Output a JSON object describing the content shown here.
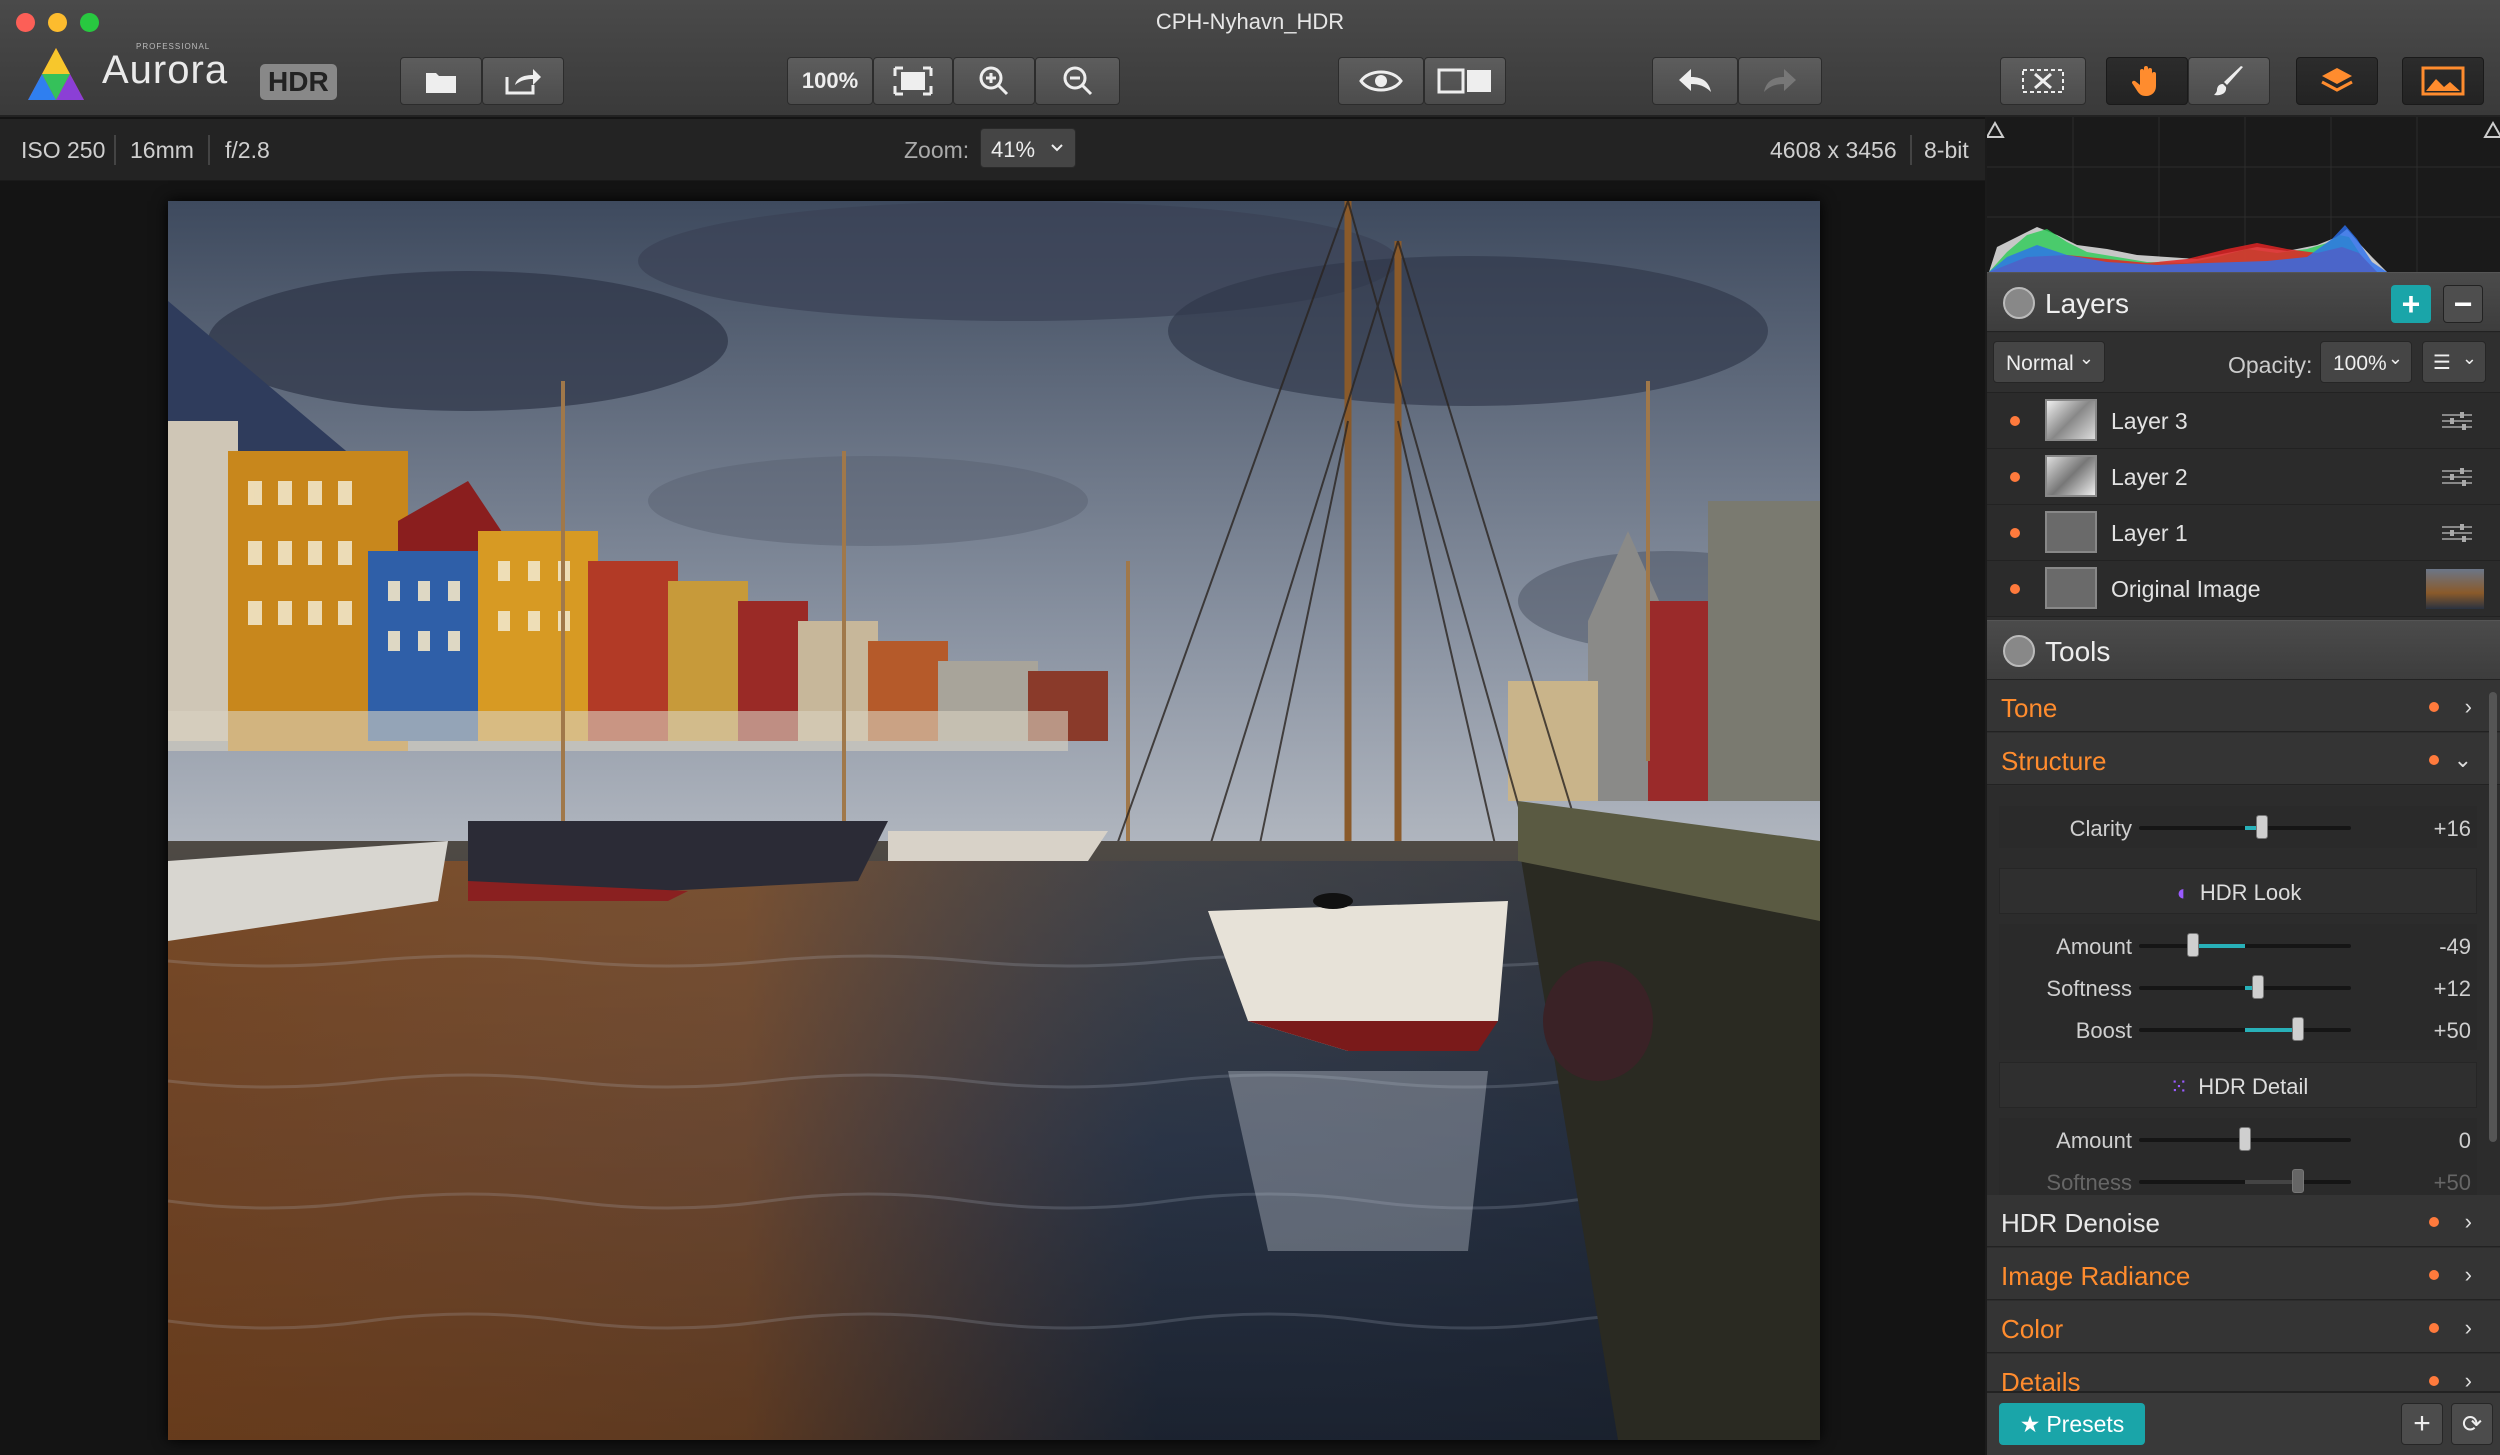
{
  "window": {
    "title": "CPH-Nyhavn_HDR"
  },
  "app": {
    "name": "Aurora",
    "edition": "HDR",
    "badge": "PROFESSIONAL"
  },
  "toolbar": {
    "zoom_100_label": "100%",
    "icons": [
      "open-icon",
      "share-icon",
      "fit-screen-icon",
      "zoom-in-icon",
      "zoom-out-icon",
      "preview-eye-icon",
      "compare-icon",
      "undo-icon",
      "redo-icon",
      "crop-icon",
      "hand-icon",
      "brush-icon",
      "layers-icon",
      "image-icon"
    ]
  },
  "info": {
    "iso": "ISO 250",
    "focal": "16mm",
    "aperture": "f/2.8",
    "zoom_label": "Zoom:",
    "zoom_value": "41%",
    "dimensions": "4608 x 3456",
    "bit_depth": "8-bit"
  },
  "layers": {
    "title": "Layers",
    "blend_mode": "Normal",
    "opacity_label": "Opacity:",
    "opacity_value": "100%",
    "items": [
      {
        "name": "Layer 3"
      },
      {
        "name": "Layer 2"
      },
      {
        "name": "Layer 1"
      },
      {
        "name": "Original Image"
      }
    ]
  },
  "tools": {
    "title": "Tools",
    "sections": {
      "tone": "Tone",
      "structure": "Structure",
      "hdr_denoise": "HDR Denoise",
      "image_radiance": "Image Radiance",
      "color": "Color",
      "details": "Details"
    },
    "clarity": {
      "label": "Clarity",
      "value": "+16",
      "level": 0.16
    },
    "hdr_look": {
      "title": "HDR Look",
      "amount": {
        "label": "Amount",
        "value": "-49",
        "level": -0.49
      },
      "softness": {
        "label": "Softness",
        "value": "+12",
        "level": 0.12
      },
      "boost": {
        "label": "Boost",
        "value": "+50",
        "level": 0.5
      }
    },
    "hdr_detail": {
      "title": "HDR Detail",
      "amount": {
        "label": "Amount",
        "value": "0",
        "level": 0
      },
      "softness": {
        "label": "Softness",
        "value": "+50",
        "level": 0.5
      }
    }
  },
  "bottom": {
    "presets_label": "Presets"
  },
  "colors": {
    "accent": "#1aa5a9",
    "section_orange": "#ff8c2e",
    "dot_orange": "#ff7a3c"
  }
}
